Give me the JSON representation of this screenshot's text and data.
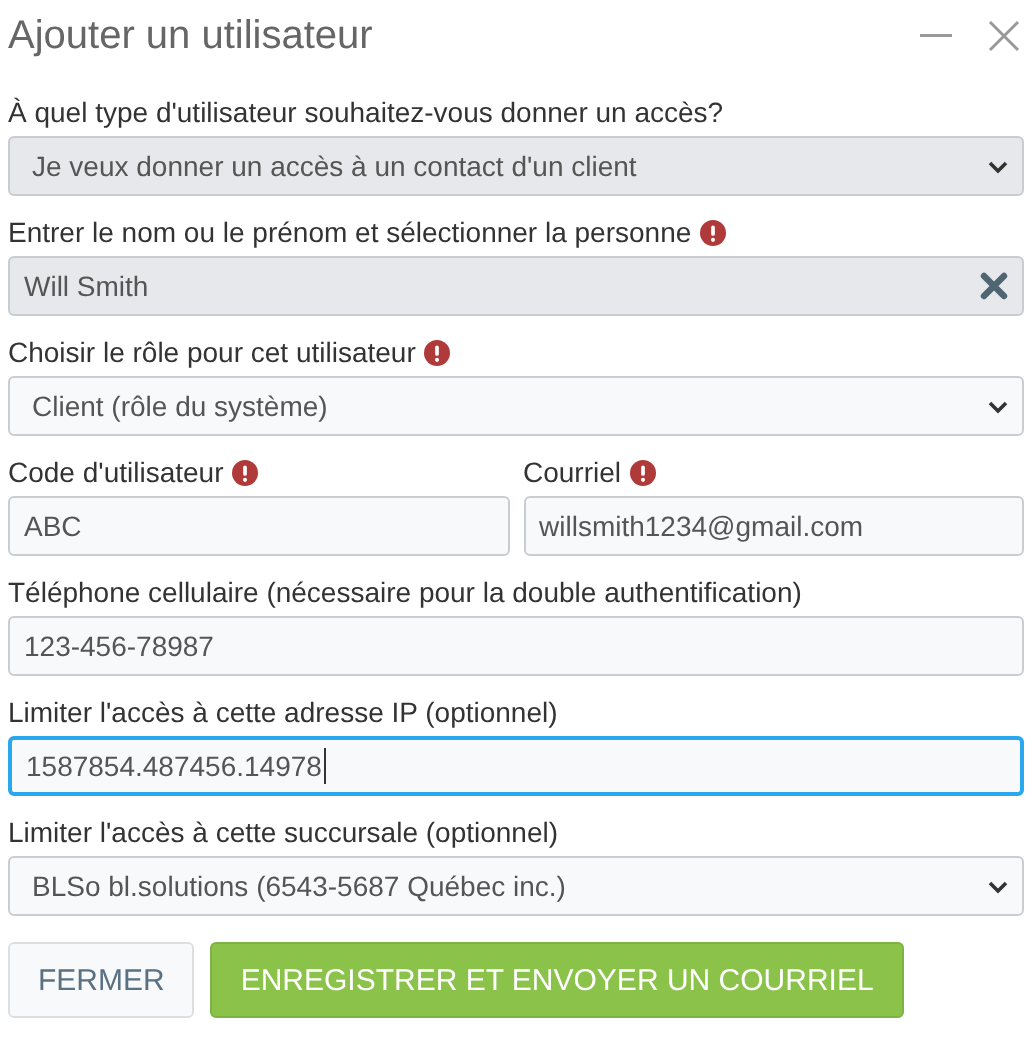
{
  "dialog": {
    "title": "Ajouter un utilisateur"
  },
  "rows": [
    {
      "fields": [
        {
          "kind": "select",
          "label": "À quel type d'utilisateur souhaitez-vous donner un accès?",
          "required": false,
          "disabled": true,
          "focused": false,
          "value": "Je veux donner un accès à un contact d'un client"
        }
      ]
    },
    {
      "fields": [
        {
          "kind": "clearable",
          "label": "Entrer le nom ou le prénom et sélectionner la personne",
          "required": true,
          "disabled": true,
          "focused": false,
          "value": "Will Smith"
        }
      ]
    },
    {
      "fields": [
        {
          "kind": "select",
          "label": "Choisir le rôle pour cet utilisateur",
          "required": true,
          "disabled": false,
          "focused": false,
          "value": "Client (rôle du système)"
        }
      ]
    },
    {
      "fields": [
        {
          "kind": "input",
          "label": "Code d'utilisateur",
          "required": true,
          "disabled": false,
          "focused": false,
          "value": "ABC"
        },
        {
          "kind": "input",
          "label": "Courriel",
          "required": true,
          "disabled": false,
          "focused": false,
          "value": "willsmith1234@gmail.com"
        }
      ]
    },
    {
      "fields": [
        {
          "kind": "input",
          "label": "Téléphone cellulaire (nécessaire pour la double authentification)",
          "required": false,
          "disabled": false,
          "focused": false,
          "value": "123-456-78987"
        }
      ]
    },
    {
      "fields": [
        {
          "kind": "input",
          "label": "Limiter l'accès à cette adresse IP (optionnel)",
          "required": false,
          "disabled": false,
          "focused": true,
          "value": "1587854.487456.14978"
        }
      ]
    },
    {
      "fields": [
        {
          "kind": "select",
          "label": "Limiter l'accès à cette succursale (optionnel)",
          "required": false,
          "disabled": false,
          "focused": false,
          "value": "BLSo bl.solutions (6543-5687 Québec inc.)"
        }
      ]
    }
  ],
  "buttons": [
    {
      "kind": "secondary",
      "label": "FERMER"
    },
    {
      "kind": "primary",
      "label": "ENREGISTRER ET ENVOYER UN COURRIEL"
    }
  ]
}
